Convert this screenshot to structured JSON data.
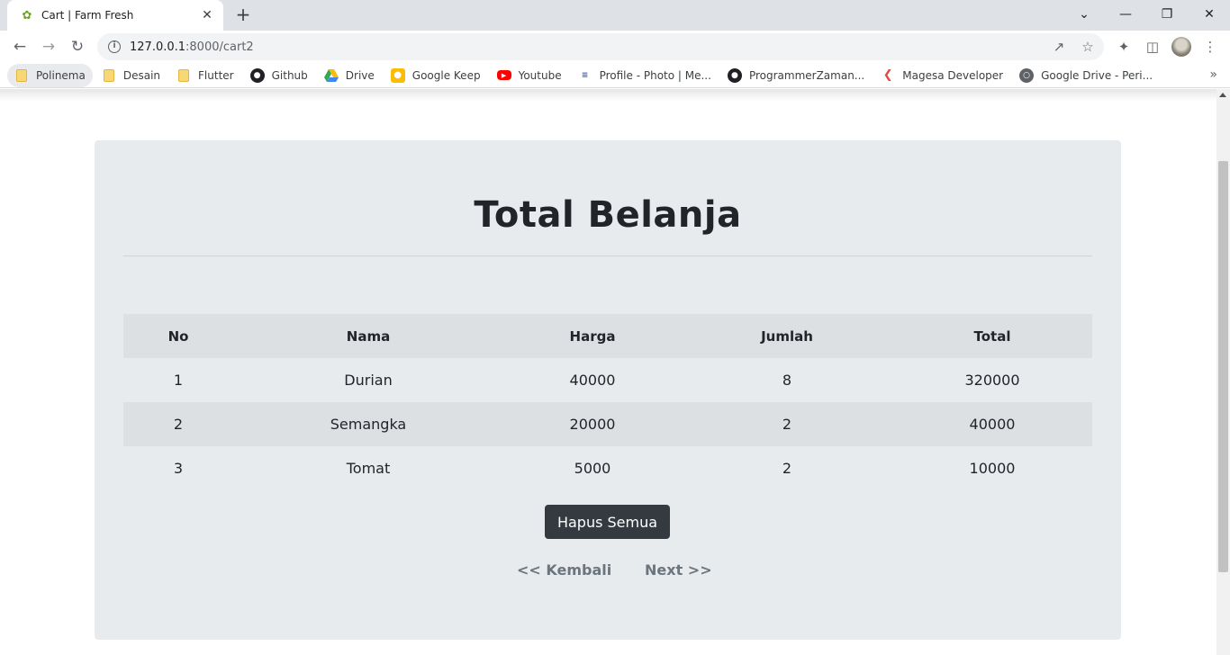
{
  "browser": {
    "tab_title": "Cart | Farm Fresh",
    "favicon": "sprout-icon",
    "url_host": "127.0.0.1",
    "url_rest": ":8000/cart2"
  },
  "bookmarks": [
    {
      "label": "Polinema",
      "icon": "folder-icon"
    },
    {
      "label": "Desain",
      "icon": "folder-icon"
    },
    {
      "label": "Flutter",
      "icon": "folder-icon"
    },
    {
      "label": "Github",
      "icon": "github-icon"
    },
    {
      "label": "Drive",
      "icon": "google-drive-icon"
    },
    {
      "label": "Google Keep",
      "icon": "google-keep-icon"
    },
    {
      "label": "Youtube",
      "icon": "youtube-icon"
    },
    {
      "label": "Profile - Photo | Me...",
      "icon": "profile-site-icon"
    },
    {
      "label": "ProgrammerZaman...",
      "icon": "github-icon"
    },
    {
      "label": "Magesa Developer",
      "icon": "magesa-icon"
    },
    {
      "label": "Google Drive - Peri...",
      "icon": "globe-icon"
    }
  ],
  "page": {
    "title": "Total Belanja",
    "table": {
      "headers": [
        "No",
        "Nama",
        "Harga",
        "Jumlah",
        "Total"
      ],
      "rows": [
        [
          "1",
          "Durian",
          "40000",
          "8",
          "320000"
        ],
        [
          "2",
          "Semangka",
          "20000",
          "2",
          "40000"
        ],
        [
          "3",
          "Tomat",
          "5000",
          "2",
          "10000"
        ]
      ]
    },
    "clear_button": "Hapus Semua",
    "back_link": "<< Kembali",
    "next_link": "Next >>"
  },
  "colors": {
    "card_bg": "#e8ebee",
    "button_bg": "#343a40",
    "link_color": "#6c757d"
  }
}
